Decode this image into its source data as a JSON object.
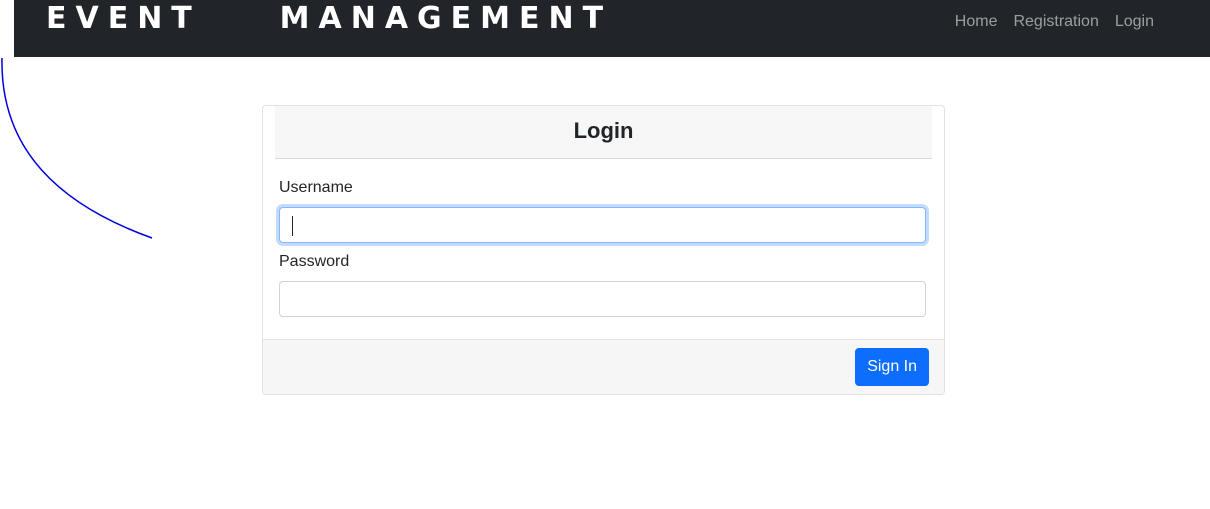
{
  "navbar": {
    "brand": "EVENT  MANAGEMENT",
    "links": [
      "Home",
      "Registration",
      "Login"
    ],
    "background": "#212529"
  },
  "login_card": {
    "title": "Login",
    "username_label": "Username",
    "username_value": "",
    "password_label": "Password",
    "password_value": "",
    "submit_label": "Sign In",
    "accent": "#0d6efd"
  }
}
